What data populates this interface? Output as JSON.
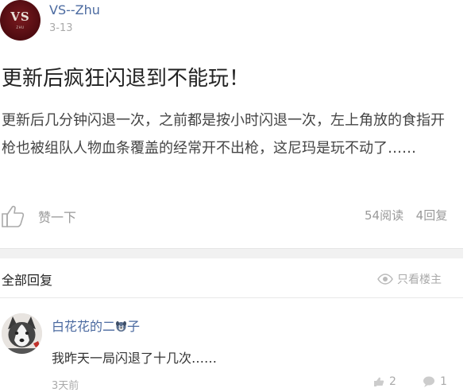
{
  "post": {
    "author": "VS--Zhu",
    "date": "3-13",
    "avatar_logo": "VS",
    "avatar_subtext": "ZHU",
    "title": "更新后疯狂闪退到不能玩！",
    "body": "更新后几分钟闪退一次，之前都是按小时闪退一次，左上角放的食指开枪也被组队人物血条覆盖的经常开不出枪，这尼玛是玩不动了……",
    "like_label": "赞一下",
    "views": "54阅读",
    "replies_count": "4回复",
    "like_icon": "thumb-up-icon"
  },
  "replies_header": {
    "label": "全部回复",
    "owner_only": "只看楼主",
    "owner_icon": "eye-icon"
  },
  "replies": [
    {
      "name_prefix": "白花花的二",
      "name_suffix": "子",
      "name_icon": "dog-emoji-icon",
      "text": "我昨天一局闪退了十几次……",
      "time": "3天前",
      "likes": "2",
      "comments": "1"
    }
  ],
  "colors": {
    "link_blue": "#4b6aa0",
    "muted_gray": "#999999",
    "avatar_red": "#5a0f14"
  }
}
